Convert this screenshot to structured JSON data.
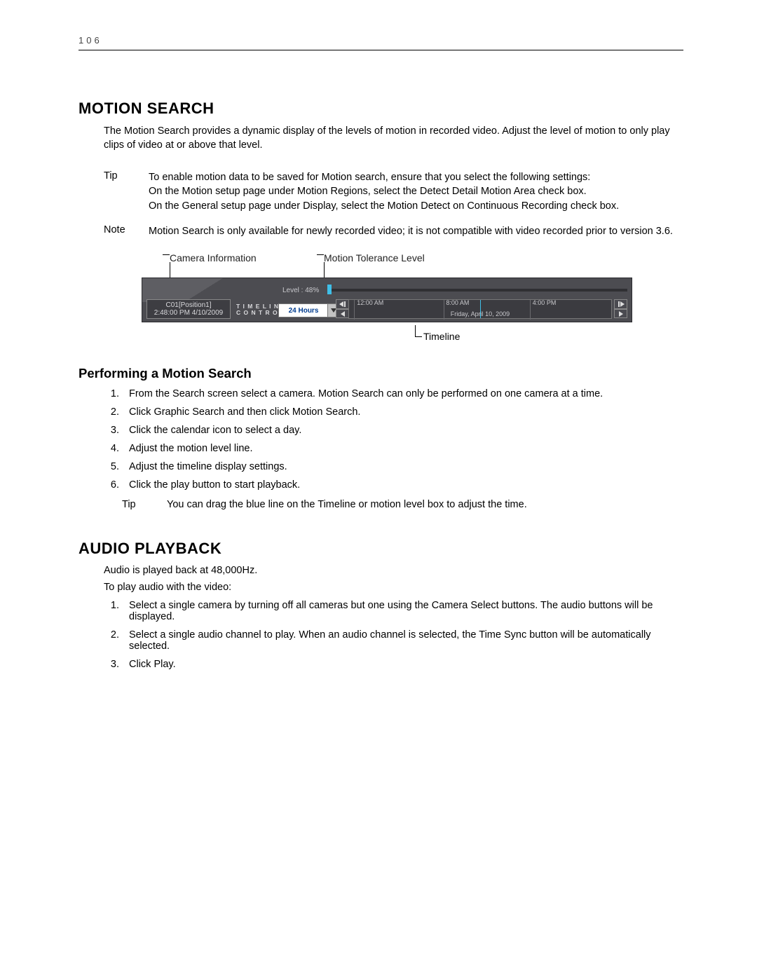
{
  "page": {
    "number": "106"
  },
  "motion": {
    "heading": "MOTION SEARCH",
    "intro": "The Motion Search provides a dynamic display of the levels of motion in recorded video. Adjust the level of motion to only play clips of video at or above that level.",
    "tip_label": "Tip",
    "tip_body_l1": "To enable motion data to be saved for Motion search, ensure that you select the following settings:",
    "tip_body_l2": "On the Motion setup page under Motion Regions, select the Detect Detail Motion Area check box.",
    "tip_body_l3": "On the General setup page under Display, select the Motion Detect on Continuous Recording check box.",
    "note_label": "Note",
    "note_body": "Motion Search is only available for newly recorded video; it is not compatible with video recorded prior to version 3.6."
  },
  "diagram": {
    "callout_cam": "Camera Information",
    "callout_level": "Motion Tolerance Level",
    "callout_timeline": "Timeline",
    "cam_name": "C01[Position1]",
    "cam_time": "2:48:00 PM  4/10/2009",
    "tl_ctrl": "TIMELINE\nCONTROL",
    "tl_ctrl_a": "T I M E L I N E",
    "tl_ctrl_b": "C O N T R O L",
    "tl_select": "24 Hours",
    "level_label": "Level :  48%",
    "ticks": [
      "12:00 AM",
      "8:00 AM",
      "4:00 PM"
    ],
    "date": "Friday, April 10, 2009"
  },
  "performing": {
    "heading": "Performing a Motion Search",
    "steps": [
      "From the Search screen select a camera. Motion Search can only be performed on one camera at a time.",
      "Click Graphic Search and then click Motion Search.",
      "Click the calendar icon to select a day.",
      "Adjust the motion level line.",
      "Adjust the timeline display settings.",
      "Click the play button to start playback."
    ],
    "tip_label": "Tip",
    "tip_body": "You can drag the blue line on the Timeline or motion level box to adjust the time."
  },
  "audio": {
    "heading": "AUDIO PLAYBACK",
    "line1": "Audio is played back at 48,000Hz.",
    "line2": "To play audio with the video:",
    "steps": [
      "Select a single camera by turning off all cameras but one using the Camera Select buttons. The audio buttons will be displayed.",
      "Select a single audio channel to play. When an audio channel is selected, the Time Sync button will be automatically selected.",
      "Click Play."
    ]
  }
}
